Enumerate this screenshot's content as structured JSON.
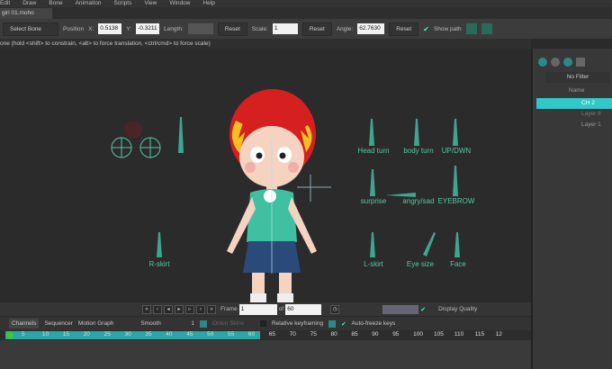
{
  "menu": [
    "Edit",
    "Draw",
    "Bone",
    "Animation",
    "Scripts",
    "View",
    "Window",
    "Help"
  ],
  "document_tab": "girl 01.moho",
  "toolbar": {
    "tool_select": "Select Bone",
    "position_label": "Position",
    "x_label": "X:",
    "x_value": "0.5138",
    "y_label": "Y:",
    "y_value": "-0.3211",
    "length_label": "Length:",
    "reset1": "Reset",
    "scale_label": "Scale:",
    "scale_value": "1",
    "reset2": "Reset",
    "angle_label": "Angle:",
    "angle_value": "62.7630",
    "reset3": "Reset",
    "show_path": "Show path"
  },
  "status": "one (hold <shift> to constrain, <alt> to force translation, <ctrl/cmd> to force scale)",
  "controls": [
    "Head turn",
    "body turn",
    "UP/DWN",
    "surprise",
    "angry/sad",
    "EYEBROW",
    "R-skirt",
    "L-skirt",
    "Eye size",
    "Face"
  ],
  "layers_panel": {
    "filter": "No Filter",
    "name_header": "Name",
    "layers": [
      "CH 2",
      "Layer 8",
      "Layer 1"
    ]
  },
  "playback": {
    "frame_label": "Frame",
    "frame": "1",
    "of_label": "of",
    "total": "60",
    "display_quality": "Display Quality"
  },
  "timeline": {
    "tabs": [
      "Channels",
      "Sequencer",
      "Motion Graph"
    ],
    "interp": "Smooth",
    "interp_num": "1",
    "onion": "Onion Skins",
    "relative": "Relative keyframing",
    "autofreeze": "Auto-freeze keys",
    "ticks": [
      "5",
      "10",
      "15",
      "20",
      "25",
      "30",
      "35",
      "40",
      "45",
      "50",
      "55",
      "60",
      "65",
      "70",
      "75",
      "80",
      "85",
      "90",
      "95",
      "100",
      "105",
      "110",
      "115",
      "12"
    ]
  },
  "colors": {
    "accent": "#2aa6a6",
    "bone": "#52c8a4"
  }
}
